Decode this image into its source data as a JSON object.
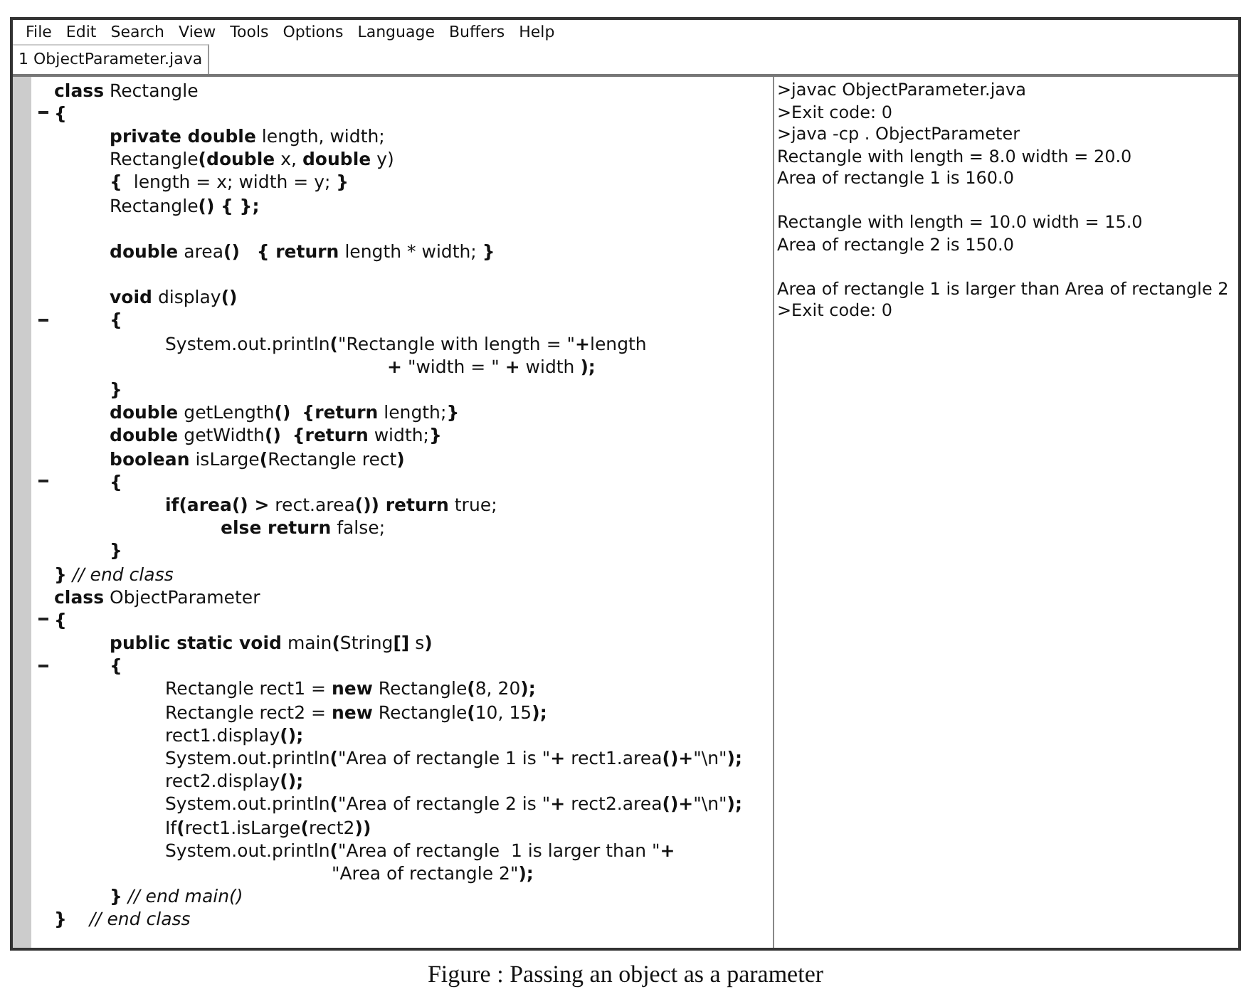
{
  "menu": [
    "File",
    "Edit",
    "Search",
    "View",
    "Tools",
    "Options",
    "Language",
    "Buffers",
    "Help"
  ],
  "tabs": [
    {
      "label": "1 ObjectParameter.java",
      "selected": true
    }
  ],
  "code_lines": [
    {
      "text": "**class** Rectangle",
      "fold": false
    },
    {
      "text": "**{**",
      "fold": true
    },
    {
      "text": "\t**private double** length, width;",
      "fold": false
    },
    {
      "text": "\tRectangle**(double** x, **double** y)",
      "fold": false
    },
    {
      "text": "\t**{**  length = x; width = y; **}**",
      "fold": false
    },
    {
      "text": "\tRectangle**() { };**",
      "fold": false
    },
    {
      "fold": false
    },
    {
      "text": "\t**double** area**()**   **{ return** length * width; **}**",
      "fold": false
    },
    {
      "fold": false
    },
    {
      "text": "\t**void** display**()**",
      "fold": false
    },
    {
      "text": "\t**{**",
      "fold": true
    },
    {
      "text": "\t\tSystem.out.println**(**\"Rectangle with length = \"**+**length",
      "fold": false
    },
    {
      "text": "\t\t\t\t\t\t**+** \"width = \" **+** width **);**",
      "fold": false
    },
    {
      "text": "\t**}**",
      "fold": false
    },
    {
      "text": "\t**double** getLength**()**  **{return** length;**}**",
      "fold": false
    },
    {
      "text": "\t**double** getWidth**()**  **{return** width;**}**",
      "fold": false
    },
    {
      "text": "\t**boolean** isLarge**(**Rectangle rect**)**",
      "fold": false
    },
    {
      "text": "\t**{**",
      "fold": true
    },
    {
      "text": "\t\t**if(area() >** rect.area**()) return** true;",
      "fold": false
    },
    {
      "text": "\t\t\t**else return** false;",
      "fold": false
    },
    {
      "text": "\t**}**",
      "fold": false
    },
    {
      "text": "**}** *// end class*",
      "fold": false
    },
    {
      "text": "**class** ObjectParameter",
      "fold": false
    },
    {
      "text": "**{**",
      "fold": true
    },
    {
      "text": "\t**public static void** main**(**String**[]** s**)**",
      "fold": false
    },
    {
      "text": "\t**{**",
      "fold": true
    },
    {
      "text": "\t\tRectangle rect1 = **new** Rectangle**(**8, 20**);**",
      "fold": false
    },
    {
      "text": "\t\tRectangle rect2 = **new** Rectangle**(**10, 15**);**",
      "fold": false
    },
    {
      "text": "\t\trect1.display**();**",
      "fold": false
    },
    {
      "text": "\t\tSystem.out.println**(**\"Area of rectangle 1 is \"**+** rect1.area**()+**\"\\n\"**);**",
      "fold": false
    },
    {
      "text": "\t\trect2.display**();**",
      "fold": false
    },
    {
      "text": "\t\tSystem.out.println**(**\"Area of rectangle 2 is \"**+** rect2.area**()+**\"\\n\"**);**",
      "fold": false
    },
    {
      "text": "\t\tIf**(**rect1.isLarge**(**rect2**))**",
      "fold": false
    },
    {
      "text": "\t\tSystem.out.println**(**\"Area of rectangle  1 is larger than \"**+**",
      "fold": false
    },
    {
      "text": "\t\t\t\t\t\"Area of rectangle 2\"**);**",
      "fold": false
    },
    {
      "text": "\t**}** *// end main()*",
      "fold": false
    },
    {
      "text": "**}**    *// end class*",
      "fold": false
    }
  ],
  "output_blocks": [
    [
      ">javac ObjectParameter.java",
      ">Exit code: 0",
      ">java -cp . ObjectParameter",
      "Rectangle with length = 8.0 width = 20.0",
      "Area of rectangle 1 is 160.0"
    ],
    [
      "Rectangle with length = 10.0 width = 15.0",
      "Area of rectangle 2 is 150.0"
    ],
    [
      "Area of rectangle 1 is larger than Area of rectangle 2",
      ">Exit code: 0"
    ]
  ],
  "caption": "Figure : Passing an object as a parameter"
}
